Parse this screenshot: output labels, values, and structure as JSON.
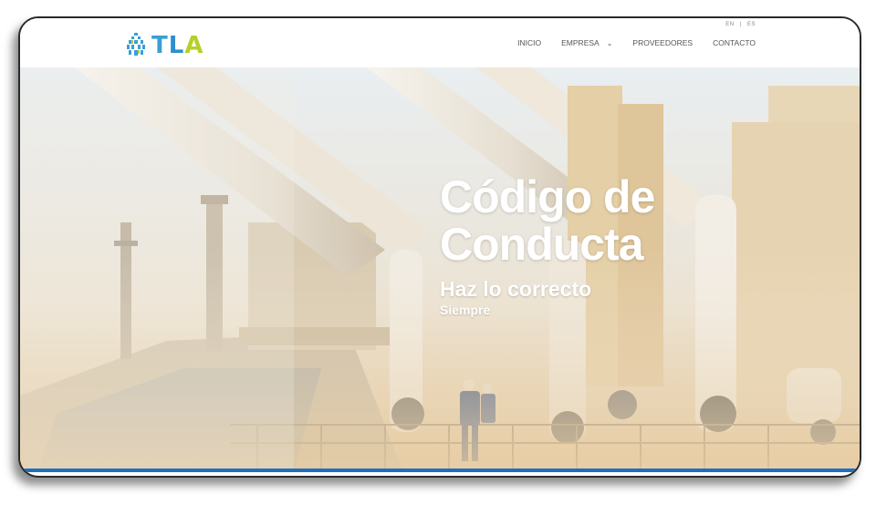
{
  "header": {
    "logo_text_t": "T",
    "logo_text_l": "L",
    "logo_text_a": "A",
    "lang_en": "EN",
    "lang_sep": "|",
    "lang_es": "ES",
    "nav": [
      {
        "label": "INICIO"
      },
      {
        "label": "EMPRESA"
      },
      {
        "label": "PROVEEDORES"
      },
      {
        "label": "CONTACTO"
      }
    ]
  },
  "hero": {
    "title_line1": "Código de",
    "title_line2": "Conducta",
    "subtitle": "Haz lo correcto",
    "subtitle2": "Siempre"
  },
  "colors": {
    "logo_blue": "#3a9fd6",
    "logo_green": "#b6cf2a",
    "accent_bar": "#1f6fc0"
  }
}
